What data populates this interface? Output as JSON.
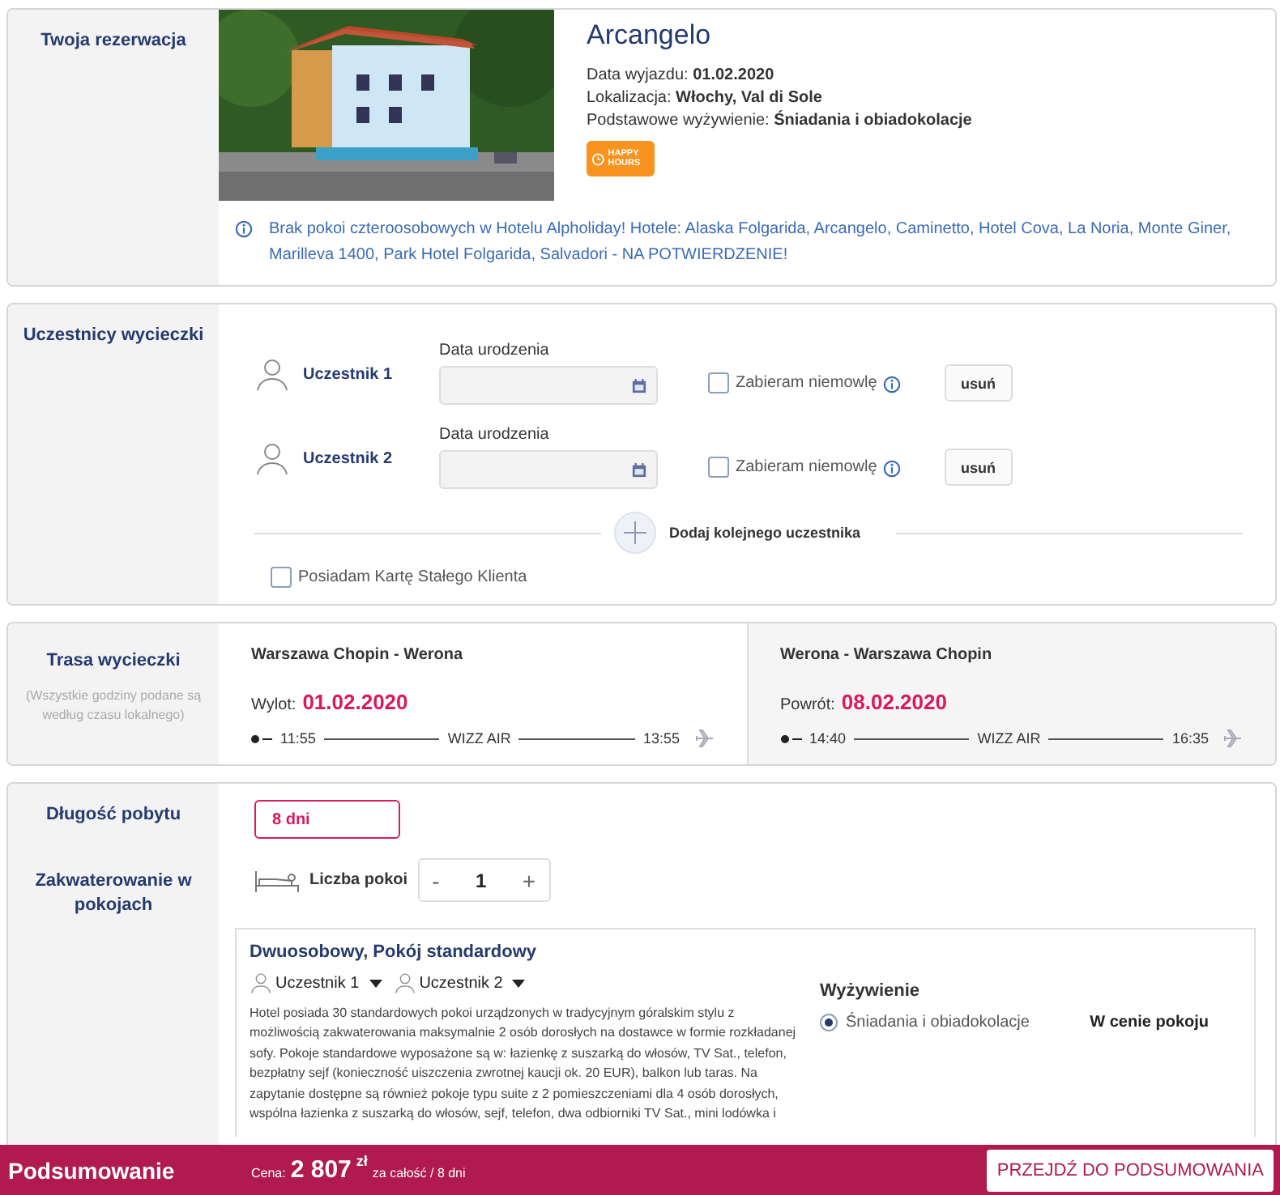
{
  "reservation": {
    "section_label": "Twoja rezerwacja",
    "hotel_name": "Arcangelo",
    "details": [
      {
        "label": "Data wyjazdu:",
        "value": "01.02.2020"
      },
      {
        "label": "Lokalizacja:",
        "value": "Włochy, Val di Sole"
      },
      {
        "label": "Podstawowe wyżywienie:",
        "value": "Śniadania i obiadokolacje"
      }
    ],
    "badge": "HAPPY HOURS",
    "notice": "Brak pokoi czteroosobowych w Hotelu Alpholiday! Hotele: Alaska Folgarida, Arcangelo, Caminetto, Hotel Cova, La Noria, Monte Giner, Marilleva 1400, Park Hotel Folgarida, Salvadori - NA POTWIERDZENIE!"
  },
  "participants": {
    "section_label": "Uczestnicy wycieczki",
    "rows": [
      {
        "name": "Uczestnik 1",
        "date_label": "Data urodzenia",
        "infant_label": "Zabieram niemowlę",
        "infant_checked": false,
        "remove_label": "usuń"
      },
      {
        "name": "Uczestnik 2",
        "date_label": "Data urodzenia",
        "infant_label": "Zabieram niemowlę",
        "infant_checked": false,
        "remove_label": "usuń"
      }
    ],
    "add_label": "Dodaj kolejnego uczestnika",
    "loyalty": {
      "label": "Posiadam Kartę Stałego Klienta",
      "checked": false
    }
  },
  "route": {
    "section_label": "Trasa wycieczki",
    "note": "(Wszystkie godziny podane są według czasu lokalnego)",
    "legs": [
      {
        "title": "Warszawa Chopin - Werona",
        "date_label": "Wylot:",
        "date": "01.02.2020",
        "depart": "11:55",
        "airline": "WIZZ AIR",
        "arrive": "13:55"
      },
      {
        "title": "Werona - Warszawa Chopin",
        "date_label": "Powrót:",
        "date": "08.02.2020",
        "depart": "14:40",
        "airline": "WIZZ AIR",
        "arrive": "16:35"
      }
    ]
  },
  "stay": {
    "length_label": "Długość pobytu",
    "length_value": "8 dni",
    "rooms_label": "Zakwaterowanie w pokojach",
    "rooms_count_label": "Liczba pokoi",
    "minus": "-",
    "rooms_count": "1",
    "plus": "+",
    "room": {
      "title": "Dwuosobowy, Pokój standardowy",
      "participants": [
        "Uczestnik 1",
        "Uczestnik 2"
      ],
      "description": "Hotel posiada 30 standardowych pokoi urządzonych w tradycyjnym góralskim stylu z możliwością zakwaterowania maksymalnie 2 osób dorosłych na dostawce w formie rozkładanej sofy. Pokoje standardowe wyposażone są w: łazienkę z suszarką do włosów, TV Sat., telefon, bezpłatny sejf (konieczność uiszczenia zwrotnej kaucji ok. 20 EUR), balkon lub taras. Na zapytanie dostępne są również pokoje typu suite z 2 pomieszczeniami dla 4 osób dorosłych, wspólna łazienka z suszarką do włosów, sejf, telefon, dwa odbiorniki TV Sat., mini lodówka i",
      "meal_heading": "Wyżywienie",
      "meals": [
        {
          "label": "Śniadania i obiadokolacje",
          "selected": true,
          "price_note": "W cenie pokoju"
        }
      ]
    }
  },
  "footer": {
    "title": "Podsumowanie",
    "price_label": "Cena:",
    "price": "2 807",
    "currency": "zł",
    "price_note": "za całość / 8 dni",
    "button": "PRZEJDŹ DO PODSUMOWANIA"
  }
}
